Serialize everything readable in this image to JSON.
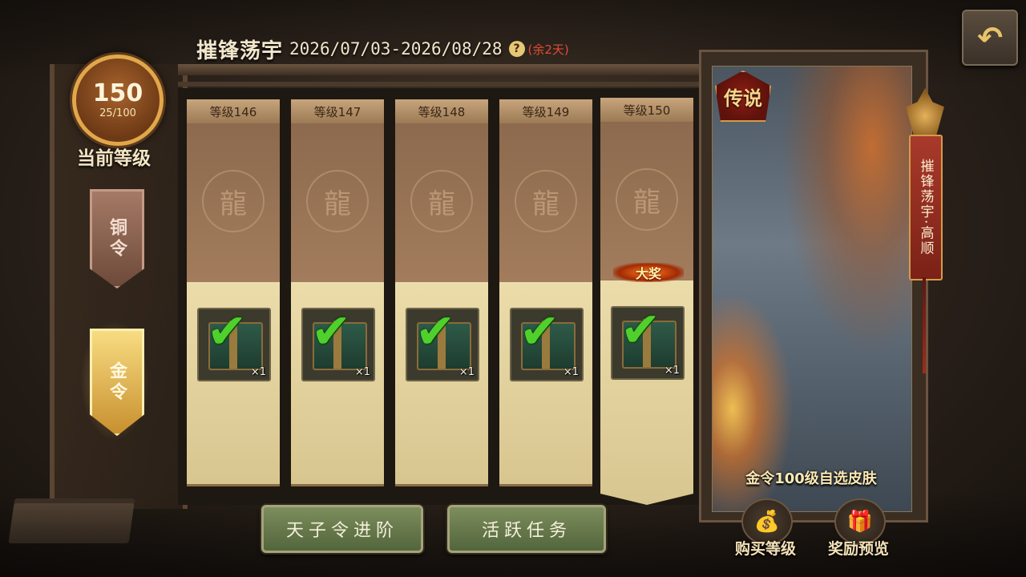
{
  "header": {
    "title": "摧锋荡宇",
    "dates": "2026/07/03-2026/08/28",
    "help_icon": "?",
    "remaining": "(余2天)"
  },
  "back_button": {
    "icon": "return-arrow-icon",
    "glyph": "↶"
  },
  "level": {
    "current": "150",
    "progress": "25/100",
    "progress_fraction": 0.25,
    "caption": "当前等级"
  },
  "tokens": {
    "bronze": "铜令",
    "gold": "金令"
  },
  "columns": [
    {
      "level_label": "等级146",
      "emblem": "龍",
      "quantity": "×1",
      "claimed": true
    },
    {
      "level_label": "等级147",
      "emblem": "龍",
      "quantity": "×1",
      "claimed": true
    },
    {
      "level_label": "等级148",
      "emblem": "龍",
      "quantity": "×1",
      "claimed": true
    },
    {
      "level_label": "等级149",
      "emblem": "龍",
      "quantity": "×1",
      "claimed": true
    },
    {
      "level_label": "等级150",
      "emblem": "龍",
      "quantity": "×1",
      "claimed": true,
      "grand_prize": "大奖"
    }
  ],
  "buttons": {
    "advance": "天子令进阶",
    "tasks": "活跃任务"
  },
  "showcase": {
    "badge": "传说",
    "caption": "金令100级自选皮肤",
    "banner": "摧锋荡宇·高顺"
  },
  "actions": {
    "buy_level": {
      "label": "购买等级",
      "icon": "money-bag-icon",
      "glyph": "💰"
    },
    "reward_preview": {
      "label": "奖励预览",
      "icon": "gift-box-icon",
      "glyph": "🎁"
    }
  },
  "colors": {
    "check": "#4fd02c",
    "gold": "#e2a74a",
    "remaining_text": "#e24b35"
  }
}
